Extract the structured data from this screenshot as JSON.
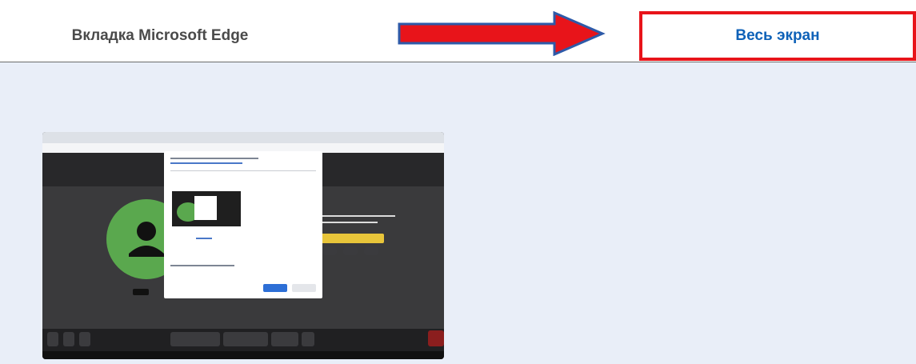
{
  "tabs": {
    "edge_tab": "Вкладка Microsoft Edge",
    "screen_tab": "Весь экран"
  },
  "colors": {
    "accent_text": "#0f62b8",
    "highlight_border": "#e8141a",
    "pane_bg": "#e9eef8"
  },
  "icons": {
    "arrow": "right-arrow-icon",
    "avatar": "user-avatar-icon"
  }
}
